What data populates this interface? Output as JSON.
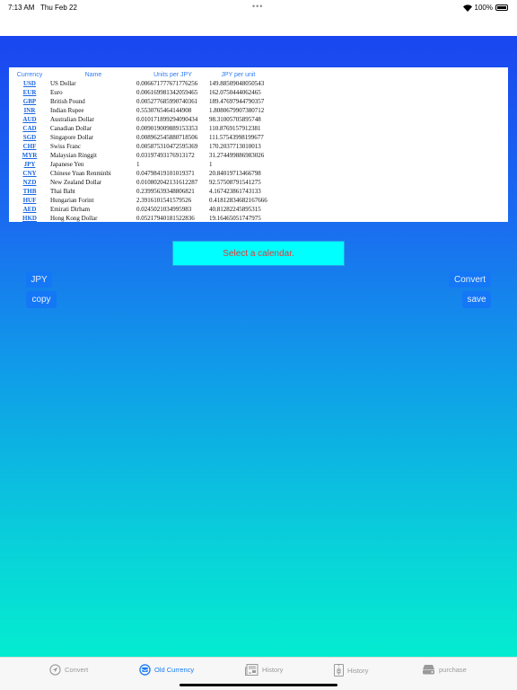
{
  "status": {
    "time": "7:13 AM",
    "date": "Thu Feb 22",
    "battery": "100%"
  },
  "table": {
    "headers": [
      "Currency",
      "Name",
      "Units per JPY",
      "JPY per unit"
    ],
    "rows": [
      [
        "USD",
        "US Dollar",
        "0.006671777671776256",
        "149.88509048050543"
      ],
      [
        "EUR",
        "Euro",
        "0.006169981342059465",
        "162.0750444062465"
      ],
      [
        "GBP",
        "British Pound",
        "0.005277685990740361",
        "189.47697944790357"
      ],
      [
        "INR",
        "Indian Rupee",
        "0.5530765464144908",
        "1.8080679907380712"
      ],
      [
        "AUD",
        "Australian Dollar",
        "0.010171899294090434",
        "98.31005705895748"
      ],
      [
        "CAD",
        "Canadian Dollar",
        "0.009019009889153353",
        "110.8769157912381"
      ],
      [
        "SGD",
        "Singapore Dollar",
        "0.008962545880718506",
        "111.57543998199677"
      ],
      [
        "CHF",
        "Swiss Franc",
        "0.005875310472595369",
        "170.2037713010013"
      ],
      [
        "MYR",
        "Malaysian Ringgit",
        "0.03197493176913172",
        "31.274499886983026"
      ],
      [
        "JPY",
        "Japanese Yen",
        "1",
        "1"
      ],
      [
        "CNY",
        "Chinese Yuan Renminbi",
        "0.04798419101019371",
        "20.84019713466798"
      ],
      [
        "NZD",
        "New Zealand Dollar",
        "0.010802042131612287",
        "92.57508791541275"
      ],
      [
        "THB",
        "Thai Baht",
        "0.23995639348806821",
        "4.167423861743133"
      ],
      [
        "HUF",
        "Hungarian Forint",
        "2.3916101541579526",
        "0.41812834682167666"
      ],
      [
        "AED",
        "Emirati Dirham",
        "0.0245021034995983",
        "40.81282245895315"
      ],
      [
        "HKD",
        "Hong Kong Dollar",
        "0.05217940181522836",
        "19.16465051747975"
      ]
    ]
  },
  "calendar_prompt": "Select a calendar.",
  "buttons": {
    "currency": "JPY",
    "copy": "copy",
    "convert": "Convert",
    "save": "save"
  },
  "tabs": [
    {
      "label": "Convert",
      "icon": "paper-plane-icon"
    },
    {
      "label": "Old Currency",
      "icon": "inbox-icon",
      "active": true
    },
    {
      "label": "History",
      "icon": "newspaper-icon"
    },
    {
      "label": "History",
      "icon": "zipper-icon"
    },
    {
      "label": "purchase",
      "icon": "drive-icon"
    }
  ],
  "colors": {
    "accent": "#1a7cf5",
    "calendar_bg": "#00ffff",
    "calendar_text": "#e23a3a"
  }
}
